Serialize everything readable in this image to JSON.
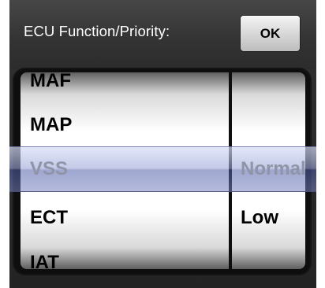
{
  "toolbar": {
    "title": "ECU Function/Priority:",
    "ok_label": "OK"
  },
  "picker": {
    "function_wheel": [
      "MAF",
      "MAP",
      "VSS",
      "ECT",
      "IAT"
    ],
    "priority_wheel": [
      "Normal",
      "Low"
    ],
    "selected_function": "VSS",
    "selected_priority": "Normal"
  }
}
